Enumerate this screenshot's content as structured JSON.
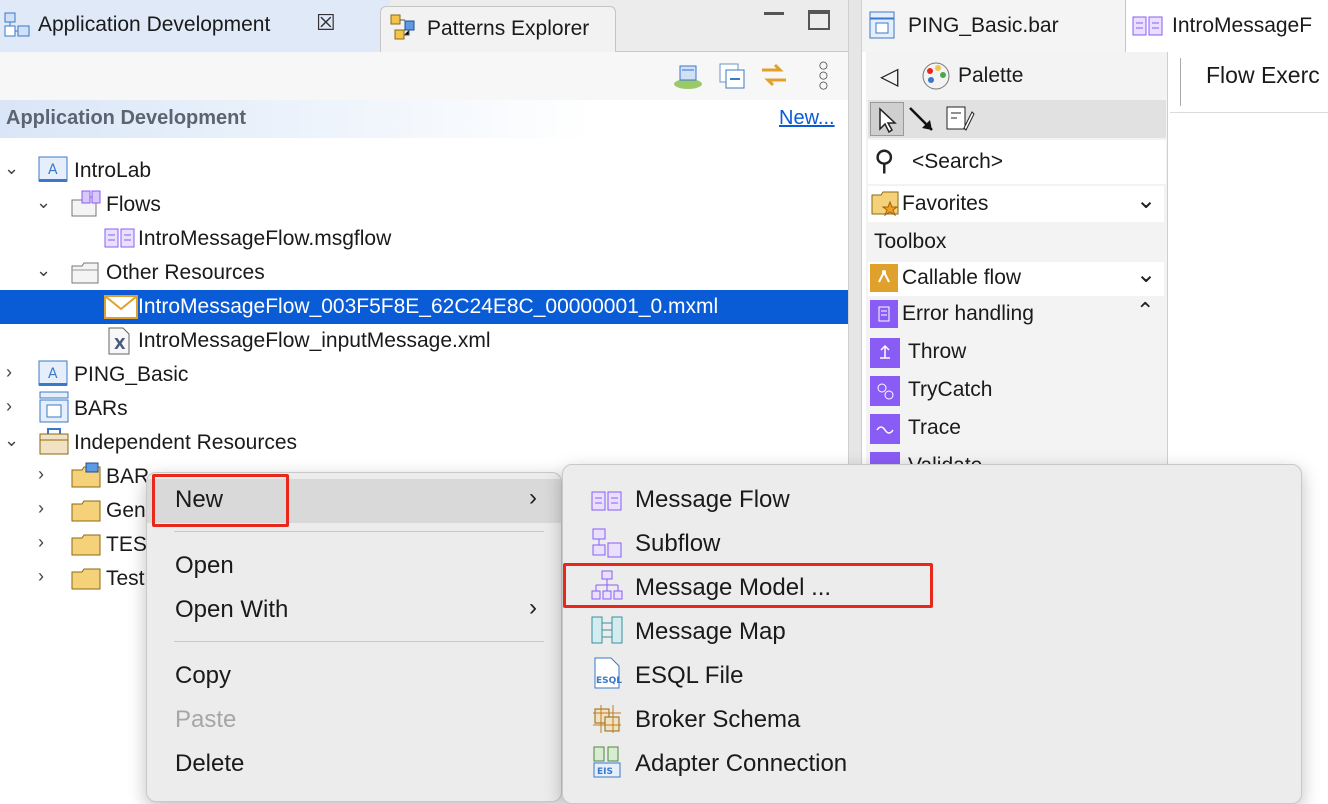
{
  "left_panel": {
    "tabs": [
      {
        "label": "Application Development",
        "active": true
      },
      {
        "label": "Patterns Explorer",
        "active": false
      }
    ],
    "header": {
      "title": "Application Development",
      "new_link": "New..."
    },
    "tree": [
      {
        "label": "IntroLab"
      },
      {
        "label": "Flows"
      },
      {
        "label": "IntroMessageFlow.msgflow"
      },
      {
        "label": "Other Resources"
      },
      {
        "label": "IntroMessageFlow_003F5F8E_62C24E8C_00000001_0.mxml"
      },
      {
        "label": "IntroMessageFlow_inputMessage.xml"
      },
      {
        "label": "PING_Basic"
      },
      {
        "label": "BARs"
      },
      {
        "label": "Independent Resources"
      },
      {
        "label": "BAR"
      },
      {
        "label": "Gen"
      },
      {
        "label": "TES"
      },
      {
        "label": "Test"
      }
    ]
  },
  "right_panel": {
    "tabs": [
      {
        "label": "PING_Basic.bar"
      },
      {
        "label": "IntroMessageF"
      }
    ],
    "palette": {
      "title": "Palette",
      "search": "<Search>",
      "favorites": "Favorites",
      "toolbox": "Toolbox",
      "callable_flow": "Callable flow",
      "error_handling": "Error handling",
      "items": [
        "Throw",
        "TryCatch",
        "Trace",
        "Validate"
      ]
    },
    "canvas_title": "Flow Exerc"
  },
  "context_menu": {
    "items": [
      {
        "label": "New",
        "submenu": true
      },
      {
        "label": "Open"
      },
      {
        "label": "Open With",
        "submenu": true
      },
      {
        "label": "Copy"
      },
      {
        "label": "Paste",
        "disabled": true
      },
      {
        "label": "Delete"
      }
    ]
  },
  "submenu": {
    "items": [
      {
        "label": "Message Flow"
      },
      {
        "label": "Subflow"
      },
      {
        "label": "Message Model ..."
      },
      {
        "label": "Message Map"
      },
      {
        "label": "ESQL File"
      },
      {
        "label": "Broker Schema"
      },
      {
        "label": "Adapter Connection"
      }
    ]
  },
  "colors": {
    "selection": "#0a5bd6",
    "highlight_box": "#e8281a",
    "link": "#0a5bd6",
    "icon_purple": "#8a5cf6"
  }
}
